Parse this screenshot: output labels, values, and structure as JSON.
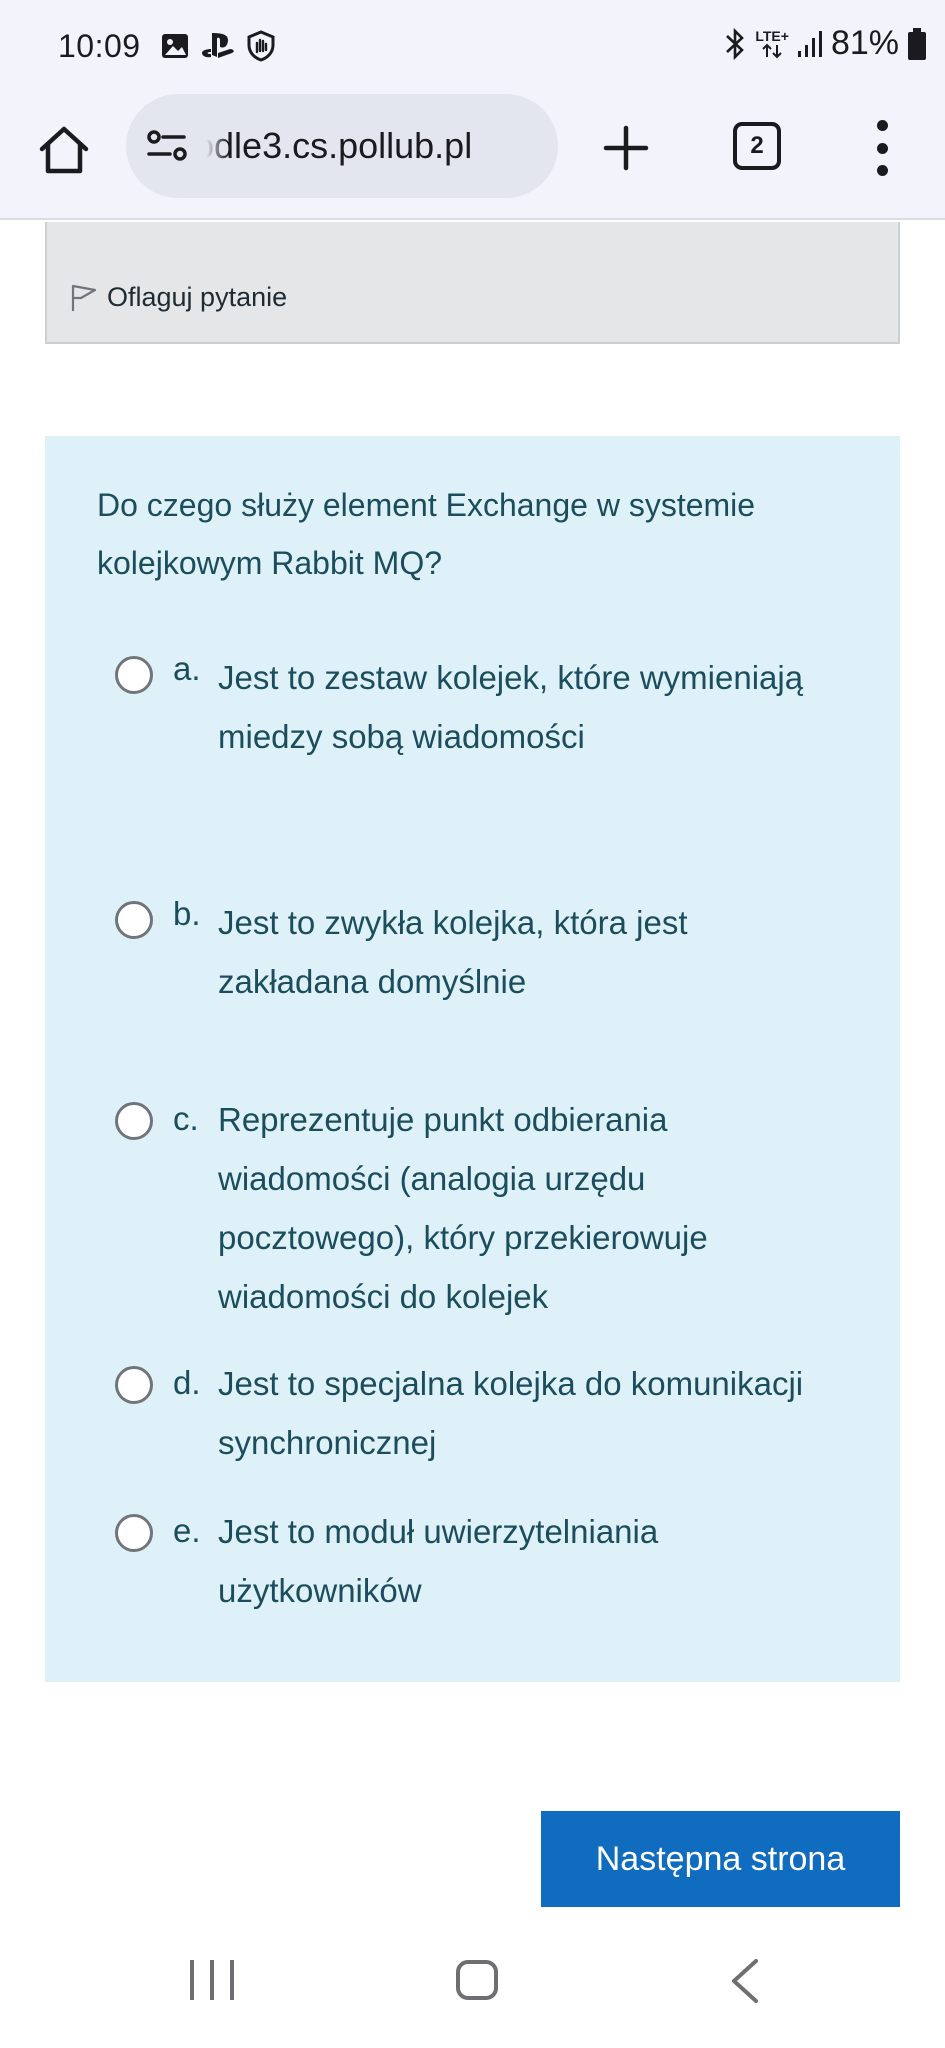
{
  "status_bar": {
    "time": "10:09",
    "network": "LTE+",
    "battery": "81%"
  },
  "browser": {
    "url": "odle3.cs.pollub.pl",
    "tab_count": "2"
  },
  "previous_question": {
    "flag_label": "Oflaguj pytanie"
  },
  "question": {
    "text": "Do czego służy element Exchange w systemie kolejkowym Rabbit MQ?",
    "options": [
      {
        "letter": "a.",
        "text": "Jest to zestaw kolejek, które wymieniają miedzy sobą wiadomości",
        "selected": false
      },
      {
        "letter": "b.",
        "text": "Jest to zwykła kolejka, która jest zakładana domyślnie",
        "selected": false
      },
      {
        "letter": "c.",
        "text": "Reprezentuje punkt odbierania wiadomości (analogia urzędu pocztowego), który przekierowuje wiadomości do kolejek",
        "selected": false
      },
      {
        "letter": "d.",
        "text": "Jest to specjalna kolejka do komunikacji synchronicznej",
        "selected": false
      },
      {
        "letter": "e.",
        "text": "Jest to moduł uwierzytelniania użytkowników",
        "selected": false
      }
    ]
  },
  "actions": {
    "next_page": "Następna strona"
  },
  "colors": {
    "question_bg": "#def1f8",
    "question_text": "#1b4d5c",
    "primary_button": "#0f6cbf",
    "info_box_bg": "#e5e6e8"
  }
}
